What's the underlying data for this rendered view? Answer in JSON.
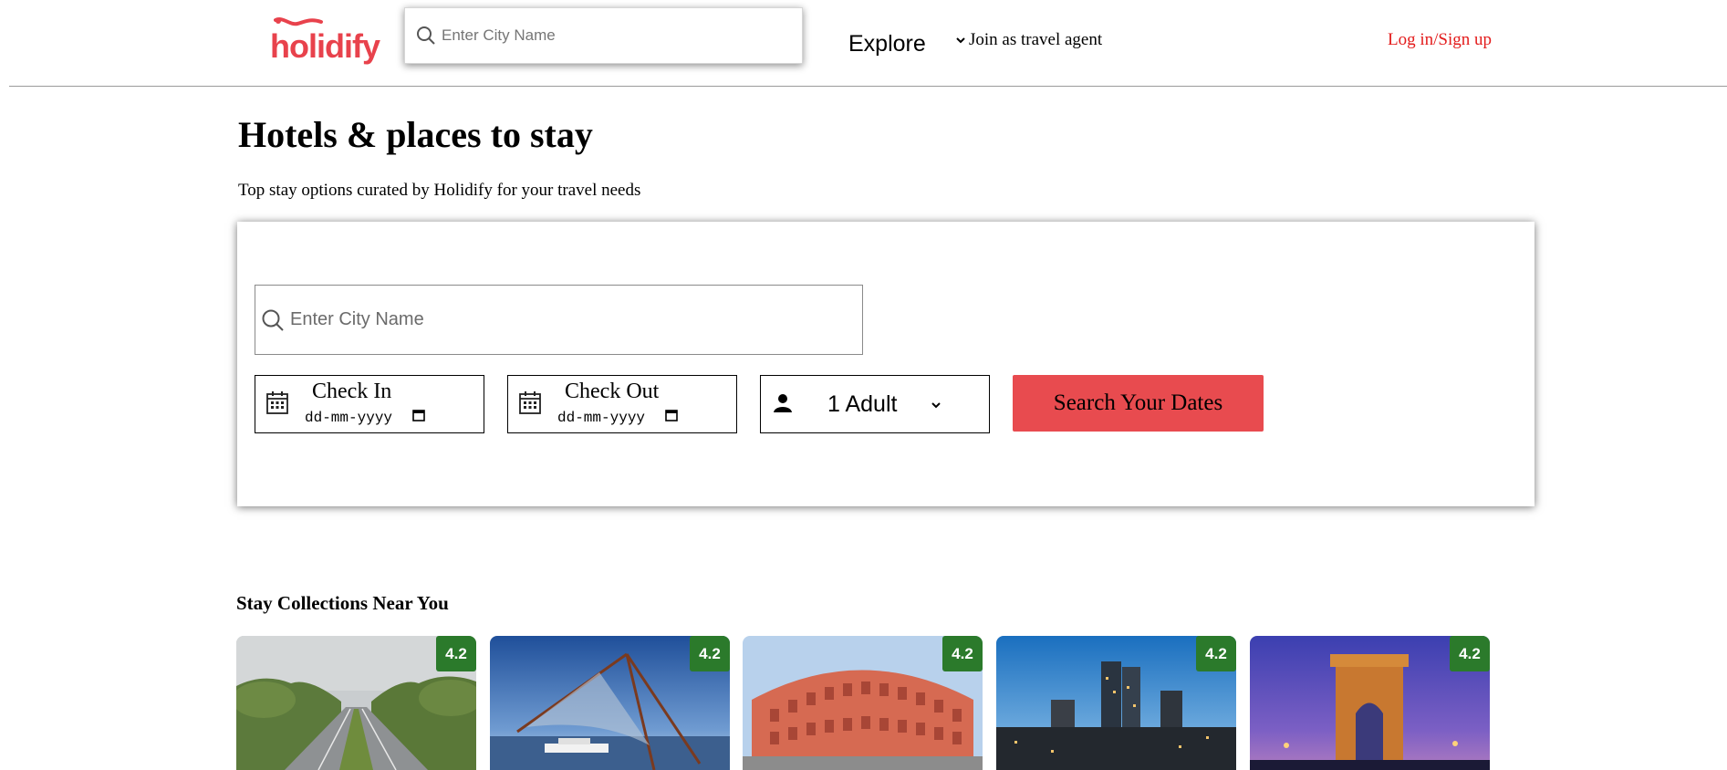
{
  "header": {
    "logo_text": "holidify",
    "search_placeholder": "Enter City Name",
    "nav_explore": "Explore",
    "nav_agent": "Join as travel agent",
    "nav_login": "Log in/Sign up",
    "brand_color": "#e8424c"
  },
  "hero": {
    "title": "Hotels & places to stay",
    "subtitle": "Top stay options curated by Holidify for your travel needs"
  },
  "search_form": {
    "city_placeholder": "Enter City Name",
    "check_in_label": "Check In",
    "check_in_value": "dd-mm-yyyy",
    "check_out_label": "Check Out",
    "check_out_value": "dd-mm-yyyy",
    "guests_value": "1 Adult",
    "submit_label": "Search Your Dates",
    "button_color": "#e84b4f"
  },
  "collections": {
    "title": "Stay Collections Near You",
    "items": [
      {
        "rating": "4.2",
        "image": "tree-lined-highway"
      },
      {
        "rating": "4.2",
        "image": "chinese-fishing-nets"
      },
      {
        "rating": "4.2",
        "image": "hawa-mahal"
      },
      {
        "rating": "4.2",
        "image": "city-skyline"
      },
      {
        "rating": "4.2",
        "image": "india-gate"
      }
    ],
    "rating_color": "#2b7a2b"
  }
}
